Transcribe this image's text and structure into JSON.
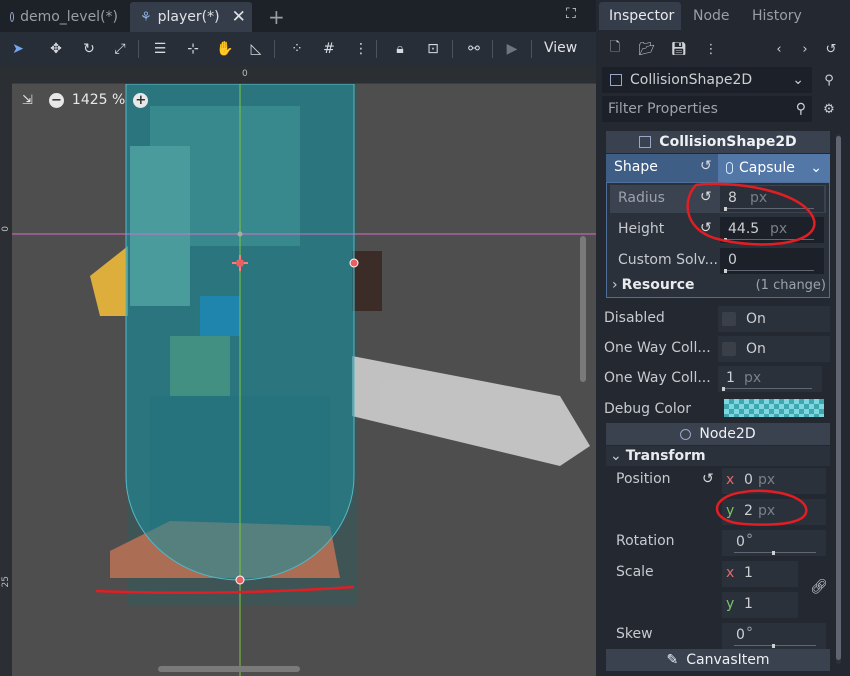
{
  "tabs": [
    {
      "label": "demo_level(*)"
    },
    {
      "label": "player(*)"
    }
  ],
  "toolbar": {
    "view_label": "View"
  },
  "viewport": {
    "zoom": "1425 %",
    "ruler_top_zero": "0",
    "ruler_left_zero": "0",
    "ruler_left_25": "25"
  },
  "inspector": {
    "tabs": {
      "inspector": "Inspector",
      "node": "Node",
      "history": "History"
    },
    "object_name": "CollisionShape2D",
    "filter_placeholder": "Filter Properties",
    "section_collision": "CollisionShape2D",
    "shape": {
      "label": "Shape",
      "value": "Capsule"
    },
    "radius": {
      "label": "Radius",
      "value": "8",
      "unit": "px"
    },
    "height": {
      "label": "Height",
      "value": "44.5",
      "unit": "px"
    },
    "custom_solver": {
      "label": "Custom Solv...",
      "value": "0"
    },
    "resource": {
      "label": "Resource",
      "changes": "(1 change)"
    },
    "disabled": {
      "label": "Disabled",
      "value": "On"
    },
    "one_way": {
      "label": "One Way Coll...",
      "value": "On"
    },
    "one_way_margin": {
      "label": "One Way Coll...",
      "value": "1",
      "unit": "px"
    },
    "debug_color": {
      "label": "Debug Color"
    },
    "section_node2d": "Node2D",
    "transform": "Transform",
    "position": {
      "label": "Position",
      "x_axis": "x",
      "x": "0",
      "y_axis": "y",
      "y": "2",
      "unit": "px"
    },
    "rotation": {
      "label": "Rotation",
      "value": "0",
      "unit": "°"
    },
    "scale": {
      "label": "Scale",
      "x_axis": "x",
      "x": "1",
      "y_axis": "y",
      "y": "1"
    },
    "skew": {
      "label": "Skew",
      "value": "0",
      "unit": "°"
    },
    "section_canvasitem": "CanvasItem"
  },
  "colors": {
    "accent": "#73a7ee",
    "capsule_fill": "#1e8c9a",
    "annotation": "#e01e24"
  }
}
